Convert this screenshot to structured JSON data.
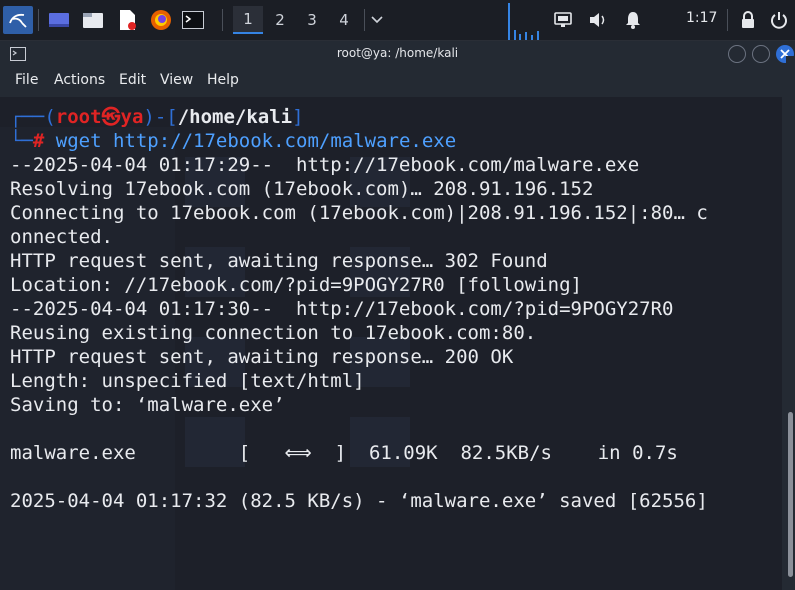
{
  "panel": {
    "workspaces": [
      "1",
      "2",
      "3",
      "4"
    ],
    "active_workspace": "1",
    "clock": "1:17",
    "icons": [
      "kali-menu-icon",
      "show-desktop-icon",
      "file-manager-icon",
      "text-editor-icon",
      "firefox-icon",
      "terminal-icon",
      "chevron-down-icon",
      "network-icon",
      "volume-icon",
      "notification-bell-icon",
      "lock-icon",
      "power-icon"
    ]
  },
  "window": {
    "title": "root@ya: /home/kali",
    "menu": [
      "File",
      "Actions",
      "Edit",
      "View",
      "Help"
    ]
  },
  "terminal": {
    "prompt": {
      "open": "┌──(",
      "user": "root㉿ya",
      "mid": ")-[",
      "cwd": "/home/kali",
      "close": "]",
      "corner": "└─",
      "hash": "#",
      "command": " wget http://17ebook.com/malware.exe"
    },
    "lines": [
      "--2025-04-04 01:17:29--  http://17ebook.com/malware.exe",
      "Resolving 17ebook.com (17ebook.com)… 208.91.196.152",
      "Connecting to 17ebook.com (17ebook.com)|208.91.196.152|:80… c",
      "onnected.",
      "HTTP request sent, awaiting response… 302 Found",
      "Location: //17ebook.com/?pid=9POGY27R0 [following]",
      "--2025-04-04 01:17:30--  http://17ebook.com/?pid=9POGY27R0",
      "Reusing existing connection to 17ebook.com:80.",
      "HTTP request sent, awaiting response… 200 OK",
      "Length: unspecified [text/html]",
      "Saving to: ‘malware.exe’",
      "",
      "malware.exe         [   ⟺  ]  61.09K  82.5KB/s    in 0.7s",
      "",
      "2025-04-04 01:17:32 (82.5 KB/s) - ‘malware.exe’ saved [62556]"
    ]
  },
  "colors": {
    "panel_bg": "#1b1e25",
    "terminal_bg": "#1d2029",
    "prompt_blue": "#2f6fd6",
    "prompt_red": "#e02424",
    "command_blue": "#4ea0ff",
    "text": "#e8eaee",
    "accent": "#3584e4"
  }
}
